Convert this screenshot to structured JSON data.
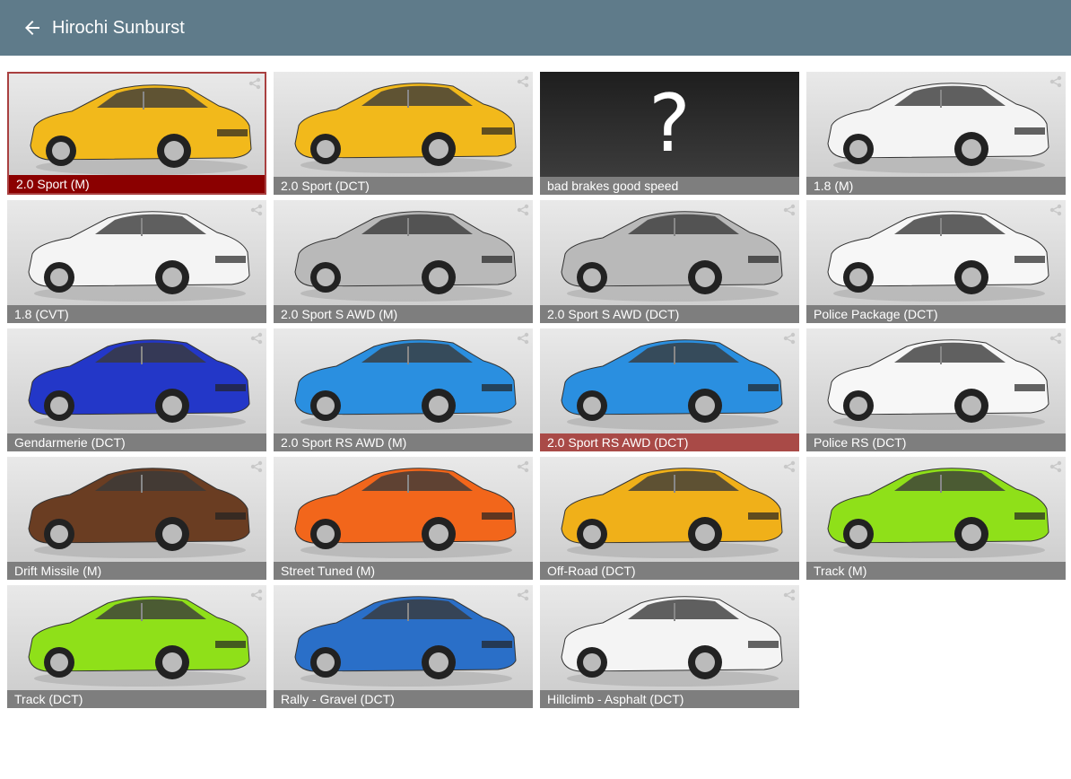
{
  "header": {
    "title": "Hirochi Sunburst"
  },
  "tiles": [
    {
      "label": "2.0 Sport (M)",
      "body": "#f2b91b",
      "state": "selected"
    },
    {
      "label": "2.0 Sport (DCT)",
      "body": "#f2b91b",
      "state": ""
    },
    {
      "label": "bad brakes good speed",
      "body": "",
      "state": "unknown"
    },
    {
      "label": "1.8 (M)",
      "body": "#f4f4f4",
      "state": ""
    },
    {
      "label": "1.8 (CVT)",
      "body": "#f4f4f4",
      "state": ""
    },
    {
      "label": "2.0 Sport S AWD (M)",
      "body": "#b9b9b9",
      "state": ""
    },
    {
      "label": "2.0 Sport S AWD (DCT)",
      "body": "#b9b9b9",
      "state": ""
    },
    {
      "label": "Police Package (DCT)",
      "body": "#f7f7f7",
      "state": ""
    },
    {
      "label": "Gendarmerie (DCT)",
      "body": "#2337c8",
      "state": ""
    },
    {
      "label": "2.0 Sport RS AWD (M)",
      "body": "#2a8fe0",
      "state": ""
    },
    {
      "label": "2.0 Sport RS AWD (DCT)",
      "body": "#2a8fe0",
      "state": "hover"
    },
    {
      "label": "Police RS (DCT)",
      "body": "#f7f7f7",
      "state": ""
    },
    {
      "label": "Drift Missile (M)",
      "body": "#6a3d22",
      "state": ""
    },
    {
      "label": "Street Tuned (M)",
      "body": "#f2661b",
      "state": ""
    },
    {
      "label": "Off-Road (DCT)",
      "body": "#f0b019",
      "state": ""
    },
    {
      "label": "Track (M)",
      "body": "#8fe019",
      "state": ""
    },
    {
      "label": "Track (DCT)",
      "body": "#8fe019",
      "state": ""
    },
    {
      "label": "Rally - Gravel (DCT)",
      "body": "#2a6fc8",
      "state": ""
    },
    {
      "label": "Hillclimb - Asphalt (DCT)",
      "body": "#f4f4f4",
      "state": ""
    }
  ],
  "icons": {
    "back": "arrow-left-icon",
    "share": "share-icon",
    "unknown": "question-mark-icon"
  },
  "unknown_glyph": "?"
}
